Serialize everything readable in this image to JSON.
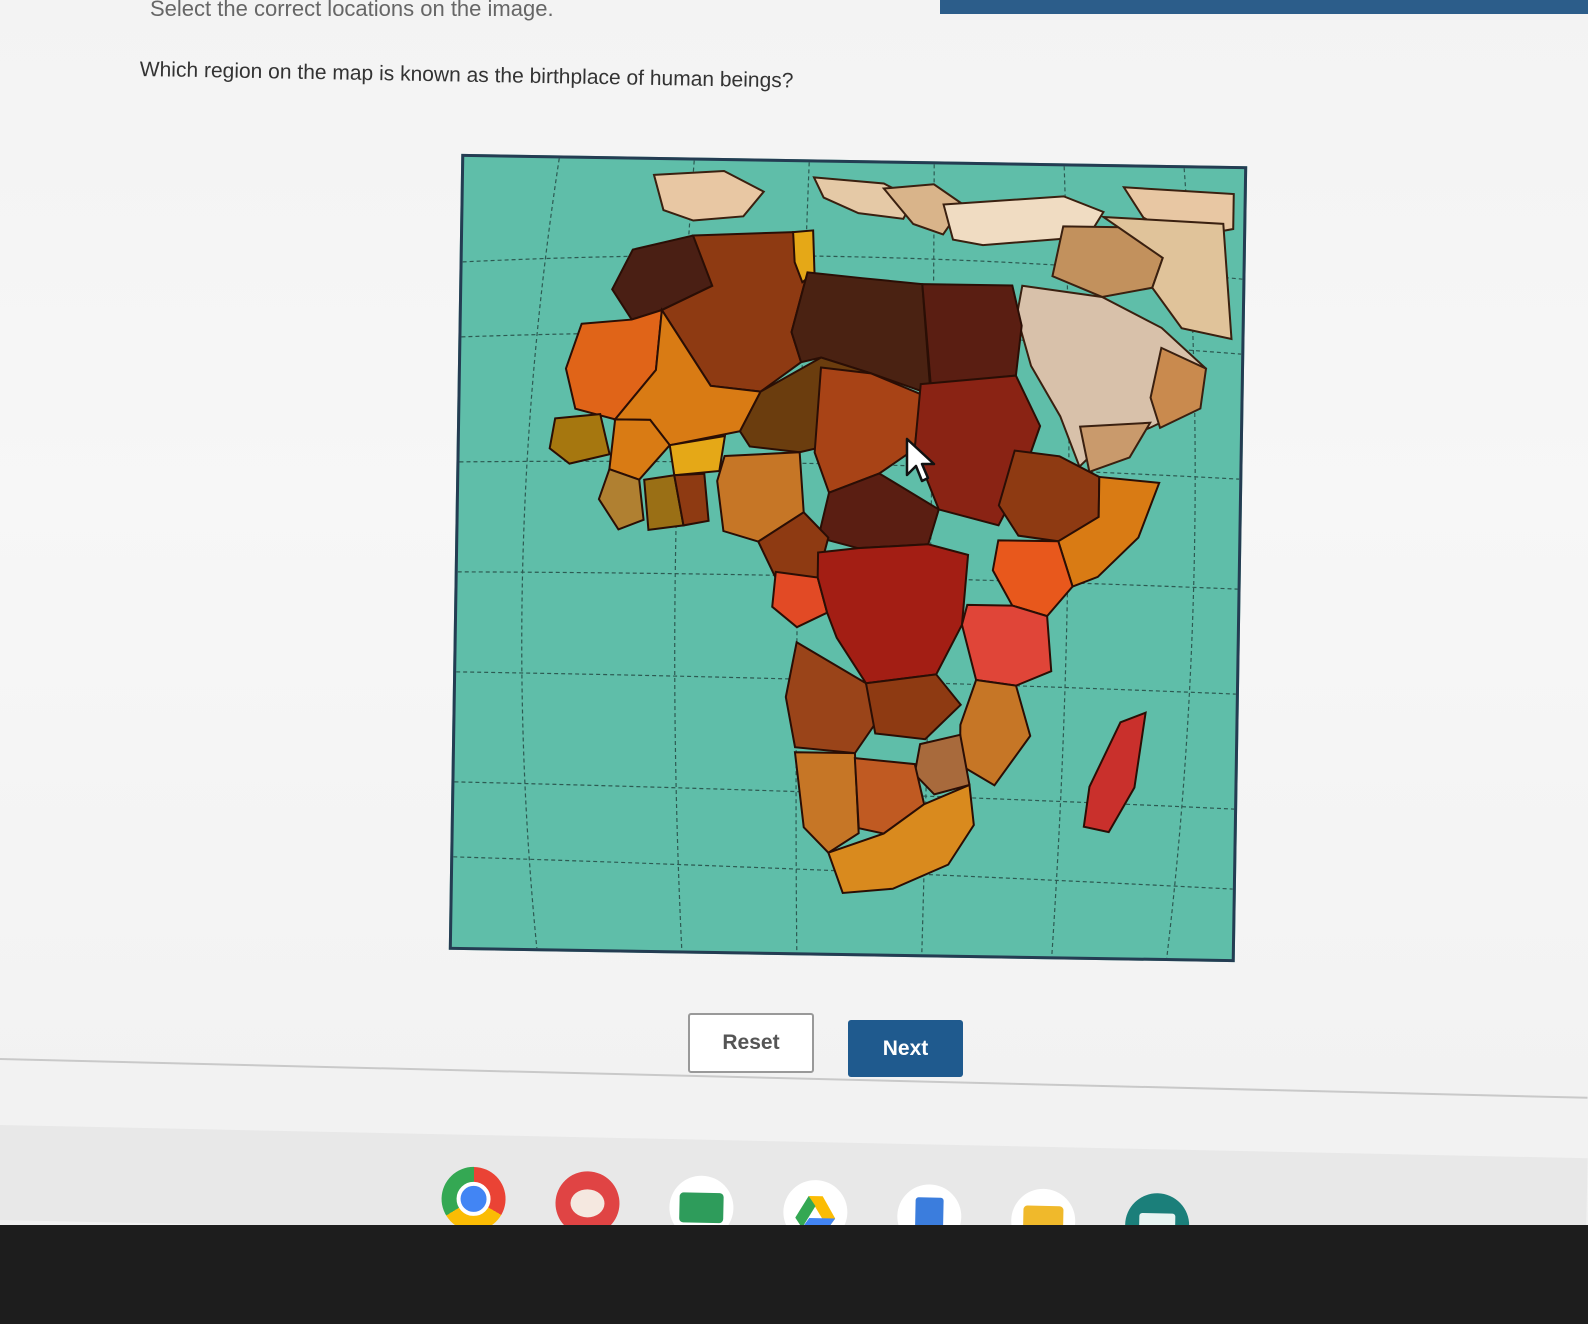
{
  "page": {
    "instruction": "Select the correct locations on the image.",
    "question": "Which region on the map is known as the birthplace of human beings?"
  },
  "buttons": {
    "reset_label": "Reset",
    "next_label": "Next"
  },
  "map": {
    "ocean_color": "#5fbea9",
    "border_color": "#243c52"
  },
  "shelf": {
    "apps": [
      {
        "name": "chrome-icon",
        "color": "#e94235"
      },
      {
        "name": "palette-icon",
        "color": "#e04444"
      },
      {
        "name": "classroom-icon",
        "color": "#2e9c5b"
      },
      {
        "name": "drive-icon",
        "color": "#2d7ae5"
      },
      {
        "name": "docs-icon",
        "color": "#3b7ddd"
      },
      {
        "name": "slides-icon",
        "color": "#f0b92b"
      },
      {
        "name": "meet-icon",
        "color": "#1b7f7a"
      }
    ]
  },
  "colors": {
    "next_button": "#1f5a8e",
    "top_bar": "#2c5d8a"
  }
}
